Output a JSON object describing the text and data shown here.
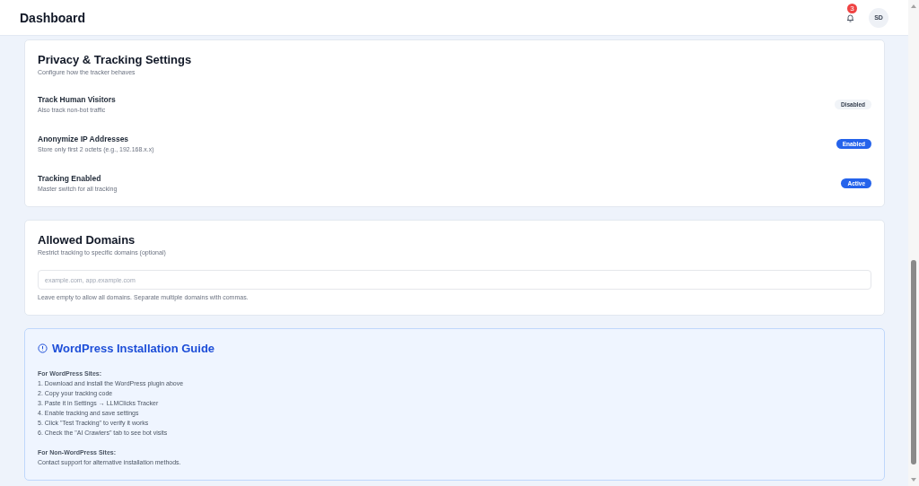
{
  "header": {
    "title": "Dashboard",
    "notification_count": "3",
    "avatar": "SD"
  },
  "privacy": {
    "title": "Privacy & Tracking Settings",
    "subtitle": "Configure how the tracker behaves",
    "settings": [
      {
        "label": "Track Human Visitors",
        "description": "Also track non-bot traffic",
        "status": "Disabled",
        "on": false
      },
      {
        "label": "Anonymize IP Addresses",
        "description": "Store only first 2 octets (e.g., 192.168.x.x)",
        "status": "Enabled",
        "on": true
      },
      {
        "label": "Tracking Enabled",
        "description": "Master switch for all tracking",
        "status": "Active",
        "on": true
      }
    ]
  },
  "domains": {
    "title": "Allowed Domains",
    "subtitle": "Restrict tracking to specific domains (optional)",
    "placeholder": "example.com, app.example.com",
    "help": "Leave empty to allow all domains. Separate multiple domains with commas."
  },
  "guide": {
    "title": "WordPress Installation Guide",
    "sections": [
      {
        "heading": "For WordPress Sites:",
        "lines": [
          "1. Download and install the WordPress plugin above",
          "2. Copy your tracking code",
          "3. Paste it in Settings → LLMClicks Tracker",
          "4. Enable tracking and save settings",
          "5. Click \"Test Tracking\" to verify it works",
          "6. Check the \"AI Crawlers\" tab to see bot visits"
        ]
      },
      {
        "heading": "For Non-WordPress Sites:",
        "lines": [
          "Contact support for alternative installation methods."
        ]
      }
    ]
  }
}
